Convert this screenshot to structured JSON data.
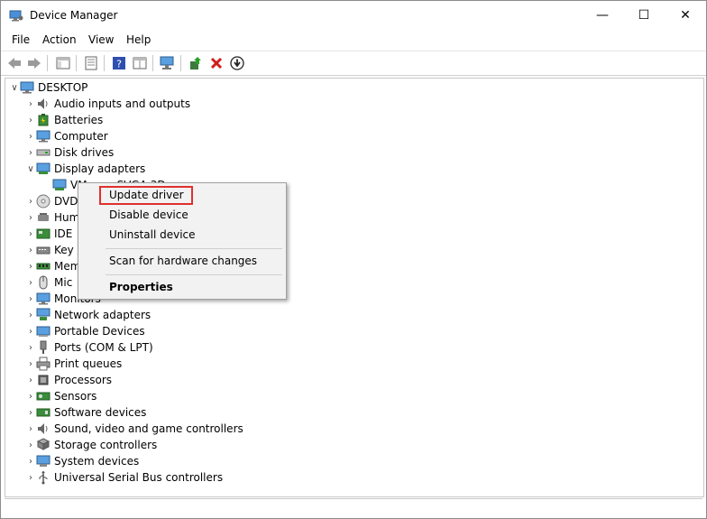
{
  "window": {
    "title": "Device Manager",
    "controls": {
      "minimize": "—",
      "maximize": "☐",
      "close": "✕"
    }
  },
  "menu": [
    "File",
    "Action",
    "View",
    "Help"
  ],
  "toolbar": {
    "icons": [
      "back-icon",
      "forward-icon",
      "show-hide-console-tree-icon",
      "properties-icon",
      "help-icon",
      "view-icon",
      "scan-hardware-icon",
      "update-driver-icon",
      "uninstall-icon",
      "disable-icon"
    ]
  },
  "tree": {
    "root": "DESKTOP",
    "items": [
      {
        "label": "Audio inputs and outputs",
        "icon": "speaker-icon"
      },
      {
        "label": "Batteries",
        "icon": "battery-icon"
      },
      {
        "label": "Computer",
        "icon": "computer-icon"
      },
      {
        "label": "Disk drives",
        "icon": "disk-icon"
      },
      {
        "label": "Display adapters",
        "icon": "display-adapter-icon",
        "expanded": true
      },
      {
        "label": "VMware SVGA 3D",
        "icon": "display-adapter-icon",
        "child": true
      },
      {
        "label": "DVD",
        "icon": "dvd-icon"
      },
      {
        "label": "Hum",
        "icon": "hid-icon"
      },
      {
        "label": "IDE",
        "icon": "ide-icon"
      },
      {
        "label": "Key",
        "icon": "keyboard-icon"
      },
      {
        "label": "Mem",
        "icon": "memory-icon"
      },
      {
        "label": "Mic",
        "icon": "mouse-icon"
      },
      {
        "label": "Monitors",
        "icon": "monitor-icon"
      },
      {
        "label": "Network adapters",
        "icon": "network-icon"
      },
      {
        "label": "Portable Devices",
        "icon": "portable-icon"
      },
      {
        "label": "Ports (COM & LPT)",
        "icon": "port-icon"
      },
      {
        "label": "Print queues",
        "icon": "printer-icon"
      },
      {
        "label": "Processors",
        "icon": "processor-icon"
      },
      {
        "label": "Sensors",
        "icon": "sensor-icon"
      },
      {
        "label": "Software devices",
        "icon": "software-icon"
      },
      {
        "label": "Sound, video and game controllers",
        "icon": "sound-icon"
      },
      {
        "label": "Storage controllers",
        "icon": "storage-icon"
      },
      {
        "label": "System devices",
        "icon": "system-icon"
      },
      {
        "label": "Universal Serial Bus controllers",
        "icon": "usb-icon"
      }
    ]
  },
  "context_menu": {
    "update": "Update driver",
    "disable": "Disable device",
    "uninstall": "Uninstall device",
    "scan": "Scan for hardware changes",
    "properties": "Properties"
  },
  "colors": {
    "highlight_border": "#e0302e",
    "accent": "#1e7cd6"
  }
}
